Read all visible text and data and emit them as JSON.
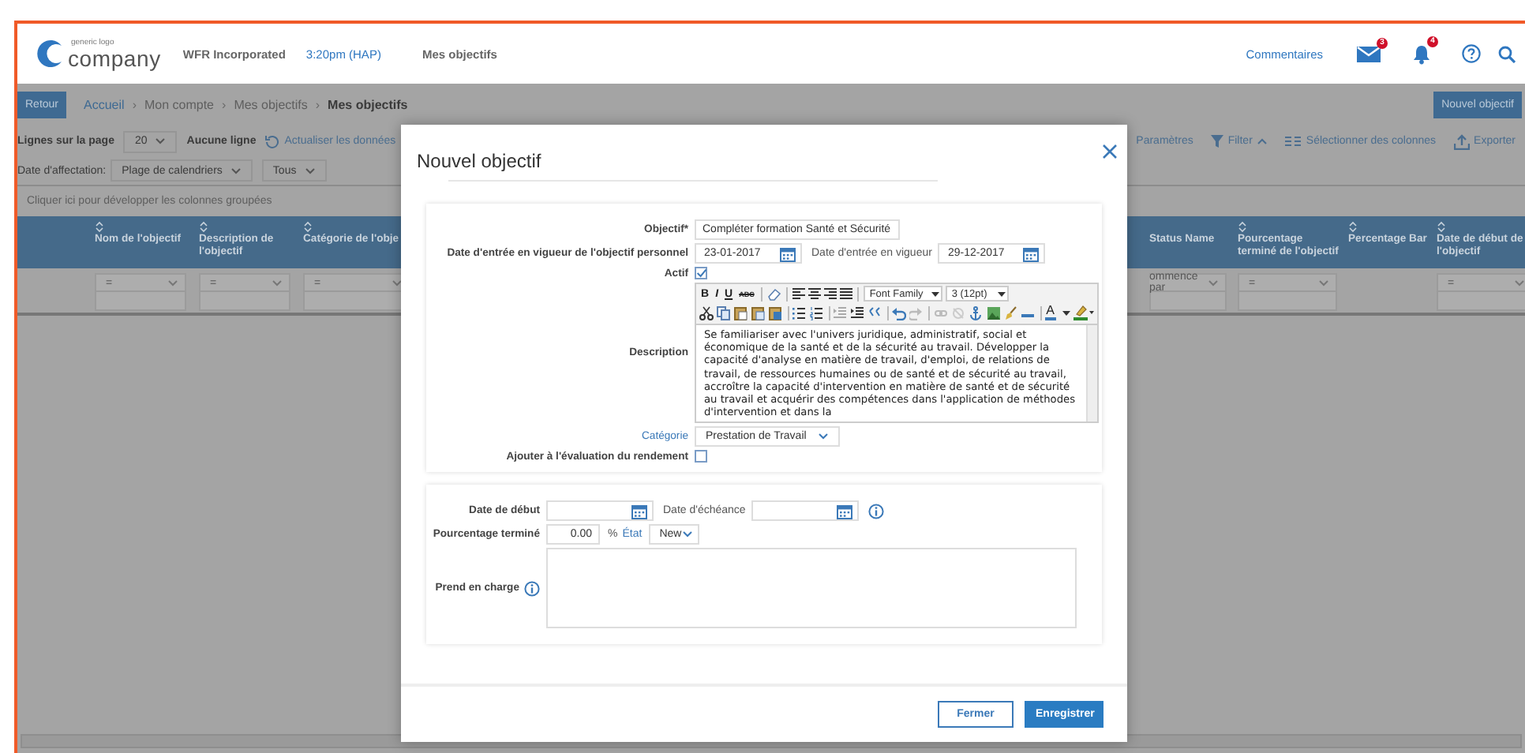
{
  "header": {
    "logo_tagline": "generic logo",
    "logo_name": "company",
    "organization": "WFR Incorporated",
    "time": "3:20pm (HAP)",
    "page": "Mes objectifs",
    "feedback": "Commentaires",
    "mail_count": "3",
    "alert_count": "4"
  },
  "toolbar": {
    "back": "Retour",
    "separator": "›",
    "breadcrumb": [
      {
        "label": "Accueil",
        "kind": "link"
      },
      {
        "label": "Mon compte",
        "kind": "plain"
      },
      {
        "label": "Mes objectifs",
        "kind": "plain"
      },
      {
        "label": "Mes objectifs",
        "kind": "current"
      }
    ],
    "new_button": "Nouvel objectif"
  },
  "controls": {
    "rows_label": "Lignes sur la page",
    "rows_value": "20",
    "rows_info": "Aucune ligne",
    "refresh": "Actualiser les données",
    "date_label": "Date d'affectation:",
    "date_range": "Plage de calendriers",
    "date_scope": "Tous",
    "settings": "Paramètres",
    "filter": "Filter",
    "columns": "Sélectionner des colonnes",
    "export": "Exporter"
  },
  "grouping_hint": "Cliquer ici pour développer les colonnes groupées",
  "table": {
    "columns_left": [
      {
        "label": "Nom de l'objectif",
        "sortable": true,
        "filter": "="
      },
      {
        "label": "Description de l'objectif",
        "sortable": true,
        "filter": "="
      },
      {
        "label": "Catégorie de l'obje",
        "sortable": true,
        "filter": "="
      }
    ],
    "columns_right": [
      {
        "label": "Status Name",
        "sortable": false,
        "filter": "ommence par"
      },
      {
        "label": "Pourcentage terminé de l'objectif",
        "sortable": true,
        "filter": "="
      },
      {
        "label": "Percentage Bar",
        "sortable": true
      },
      {
        "label": "Date de début de l'objectif",
        "sortable": true,
        "filter": "="
      }
    ]
  },
  "dialog": {
    "title": "Nouvel objectif",
    "objective": {
      "label": "Objectif*",
      "value": "Compléter formation Santé et Sécurité"
    },
    "personal_date": {
      "label": "Date d'entrée en vigueur de l'objectif personnel",
      "value": "23-01-2017"
    },
    "effective_date": {
      "label": "Date d'entrée en vigueur",
      "value": "29-12-2017"
    },
    "active": {
      "label": "Actif",
      "checked": true
    },
    "description": {
      "label": "Description",
      "format_buttons": [
        "B",
        "I",
        "U",
        "ABC"
      ],
      "font_family": "Font Family",
      "font_size": "3 (12pt)",
      "color_button": "A",
      "text": "Se familiariser avec l'univers juridique, administratif, social et économique de la santé et de la sécurité au travail. Développer la capacité d'analyse en matière de travail, d'emploi, de relations de travail, de ressources humaines ou de santé et de sécurité au travail, accroître la capacité d'intervention en matière de santé et de sécurité au travail et acquérir des compétences dans l'application de méthodes d'intervention et dans la"
    },
    "category": {
      "label": "Catégorie",
      "value": "Prestation de Travail"
    },
    "performance_review": {
      "label": "Ajouter à l'évaluation du rendement",
      "checked": false
    },
    "start_date": {
      "label": "Date de début"
    },
    "due_date": {
      "label": "Date d'échéance"
    },
    "percent": {
      "label": "Pourcentage terminé",
      "value": "0.00",
      "unit": "%"
    },
    "state": {
      "label": "État",
      "value": "New"
    },
    "support": {
      "label": "Prend en charge"
    },
    "buttons": [
      {
        "label": "Fermer",
        "kind": "secondary"
      },
      {
        "label": "Enregistrer",
        "kind": "primary"
      }
    ]
  }
}
